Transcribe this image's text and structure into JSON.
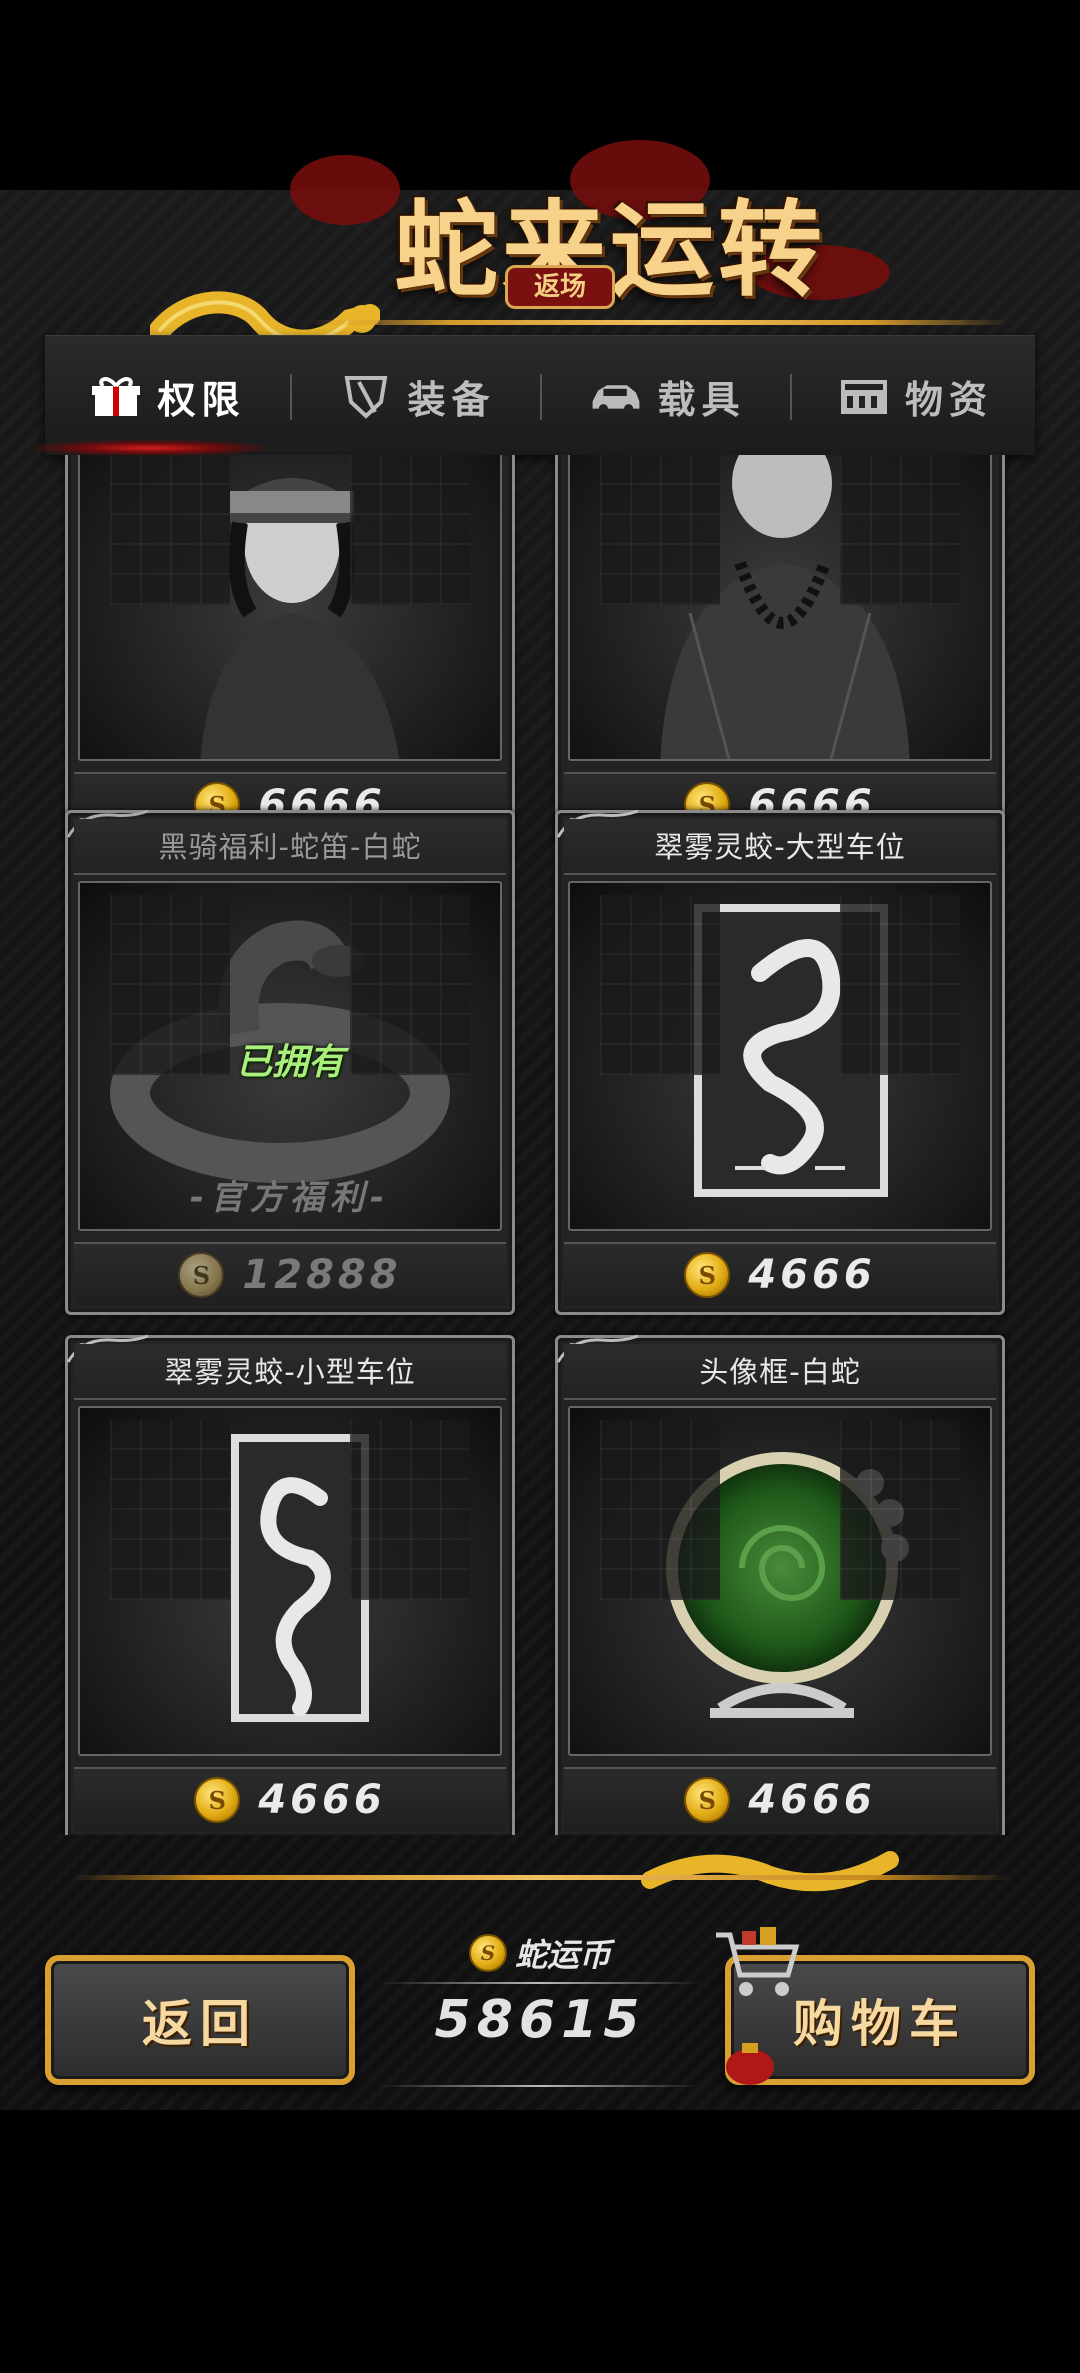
{
  "header": {
    "title": "蛇来运转",
    "seal": "返场"
  },
  "tabs": [
    {
      "label": "权限",
      "icon": "gift-box-icon",
      "active": true
    },
    {
      "label": "装备",
      "icon": "shield-icon",
      "active": false
    },
    {
      "label": "载具",
      "icon": "car-icon",
      "active": false
    },
    {
      "label": "物资",
      "icon": "cabinet-icon",
      "active": false
    }
  ],
  "cards": [
    {
      "title": "",
      "price": "6666",
      "image": "woman-portrait"
    },
    {
      "title": "",
      "price": "6666",
      "image": "monk-portrait"
    },
    {
      "title": "黑骑福利-蛇笛-白蛇",
      "price": "12888",
      "image": "coiled-snake",
      "owned_label": "已拥有",
      "official_label": "-官方福利-",
      "dim": true
    },
    {
      "title": "翠雾灵蛟-大型车位",
      "price": "4666",
      "image": "snake-card-large"
    },
    {
      "title": "翠雾灵蛟-小型车位",
      "price": "4666",
      "image": "snake-card-small"
    },
    {
      "title": "头像框-白蛇",
      "price": "4666",
      "image": "jade-frame"
    }
  ],
  "footer": {
    "back_label": "返回",
    "cart_label": "购物车",
    "currency_label": "蛇运币",
    "currency_amount": "58615"
  },
  "colors": {
    "gold": "#d9a030",
    "owned_green": "#a8f07a",
    "tab_active_glow": "#dc1e1e"
  }
}
